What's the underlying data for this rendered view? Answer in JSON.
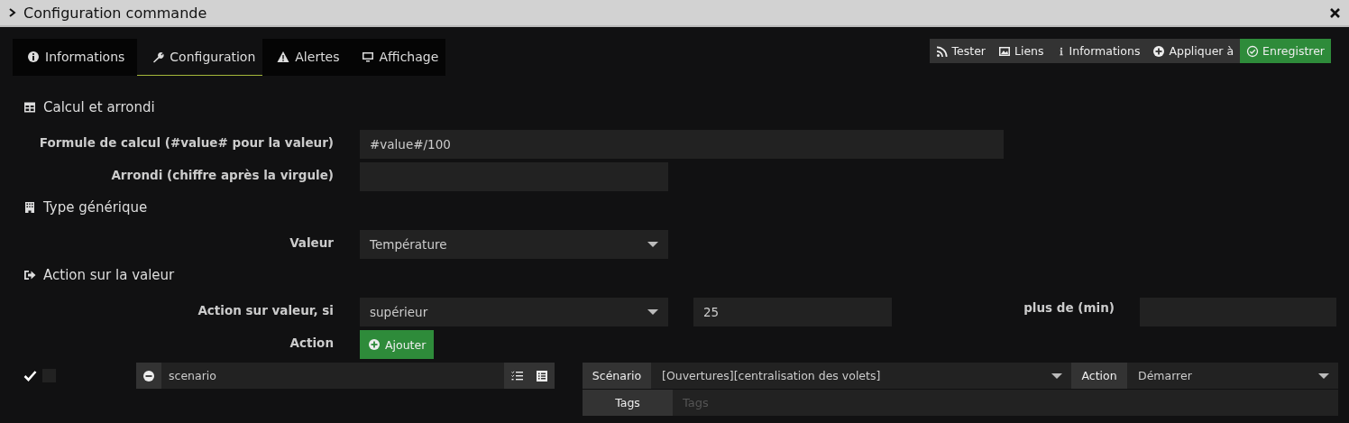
{
  "window": {
    "title": "Configuration commande"
  },
  "tabs": [
    {
      "label": "Informations",
      "selected": false
    },
    {
      "label": "Configuration",
      "selected": true
    },
    {
      "label": "Alertes",
      "selected": false
    },
    {
      "label": "Affichage",
      "selected": false
    }
  ],
  "toolbar": [
    {
      "label": "Tester",
      "kind": "plain"
    },
    {
      "label": "Liens",
      "kind": "plain"
    },
    {
      "label": "Informations",
      "kind": "plain"
    },
    {
      "label": "Appliquer à",
      "kind": "plain"
    },
    {
      "label": "Enregistrer",
      "kind": "success"
    }
  ],
  "sections": [
    {
      "title": "Calcul et arrondi",
      "fields": [
        {
          "label": "Formule de calcul (#value# pour la valeur)",
          "kind": "wide-input",
          "value": "#value#/100"
        },
        {
          "label": "Arrondi (chiffre après la virgule)",
          "kind": "input"
        }
      ]
    },
    {
      "title": "Type générique",
      "fields": [
        {
          "label": "Valeur",
          "kind": "select",
          "value": "Température"
        }
      ]
    },
    {
      "title": "Action sur la valeur",
      "fields": [
        {
          "label": "Action sur valeur, si",
          "kind": "condition",
          "value": "supérieur",
          "threshold": "25",
          "duration_label": "plus de (min)"
        },
        {
          "label": "Action",
          "kind": "button",
          "button": "Ajouter"
        }
      ]
    }
  ],
  "action_row": {
    "checkboxes": [
      {
        "checked": true
      },
      {
        "checked": false
      }
    ],
    "command": "scenario",
    "scenario_label": "Scénario",
    "scenario": "[Ouvertures][centralisation des volets]",
    "action_label": "Action",
    "action": "Démarrer",
    "tags_label": "Tags",
    "tags_placeholder": "Tags"
  }
}
